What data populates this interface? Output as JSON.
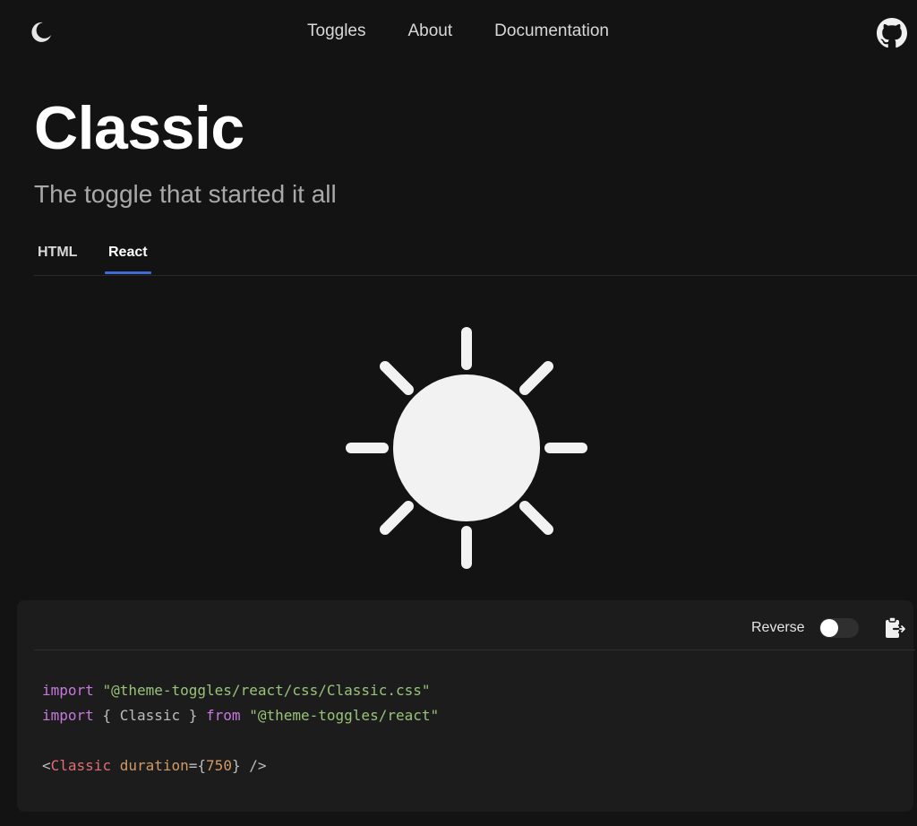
{
  "header": {
    "logo_icon": "moon-icon",
    "nav": [
      {
        "label": "Toggles"
      },
      {
        "label": "About"
      },
      {
        "label": "Documentation"
      }
    ],
    "github_icon": "github-icon"
  },
  "page": {
    "title": "Classic",
    "subtitle": "The toggle that started it all"
  },
  "tabs": [
    {
      "label": "HTML",
      "active": false
    },
    {
      "label": "React",
      "active": true
    }
  ],
  "toggle": {
    "icon": "sun-icon",
    "color": "#f2f2f2"
  },
  "code_panel": {
    "reverse_label": "Reverse",
    "reverse_on": false,
    "copy_icon": "clipboard-copy-icon",
    "lines": {
      "l1_kw": "import",
      "l1_str": "\"@theme-toggles/react/css/Classic.css\"",
      "l2_kw": "import",
      "l2_mid": " { Classic } ",
      "l2_kw2": "from",
      "l2_str": "\"@theme-toggles/react\"",
      "l3_open": "<",
      "l3_tag": "Classic",
      "l3_attr": " duration",
      "l3_eq": "={",
      "l3_num": "750",
      "l3_close": "} />"
    }
  },
  "colors": {
    "background": "#131313",
    "panel": "#1c1c1c",
    "accent": "#3d6bd8",
    "keyword": "#c678dd",
    "string": "#98c379",
    "tag": "#e06c75",
    "number": "#d19a66"
  }
}
